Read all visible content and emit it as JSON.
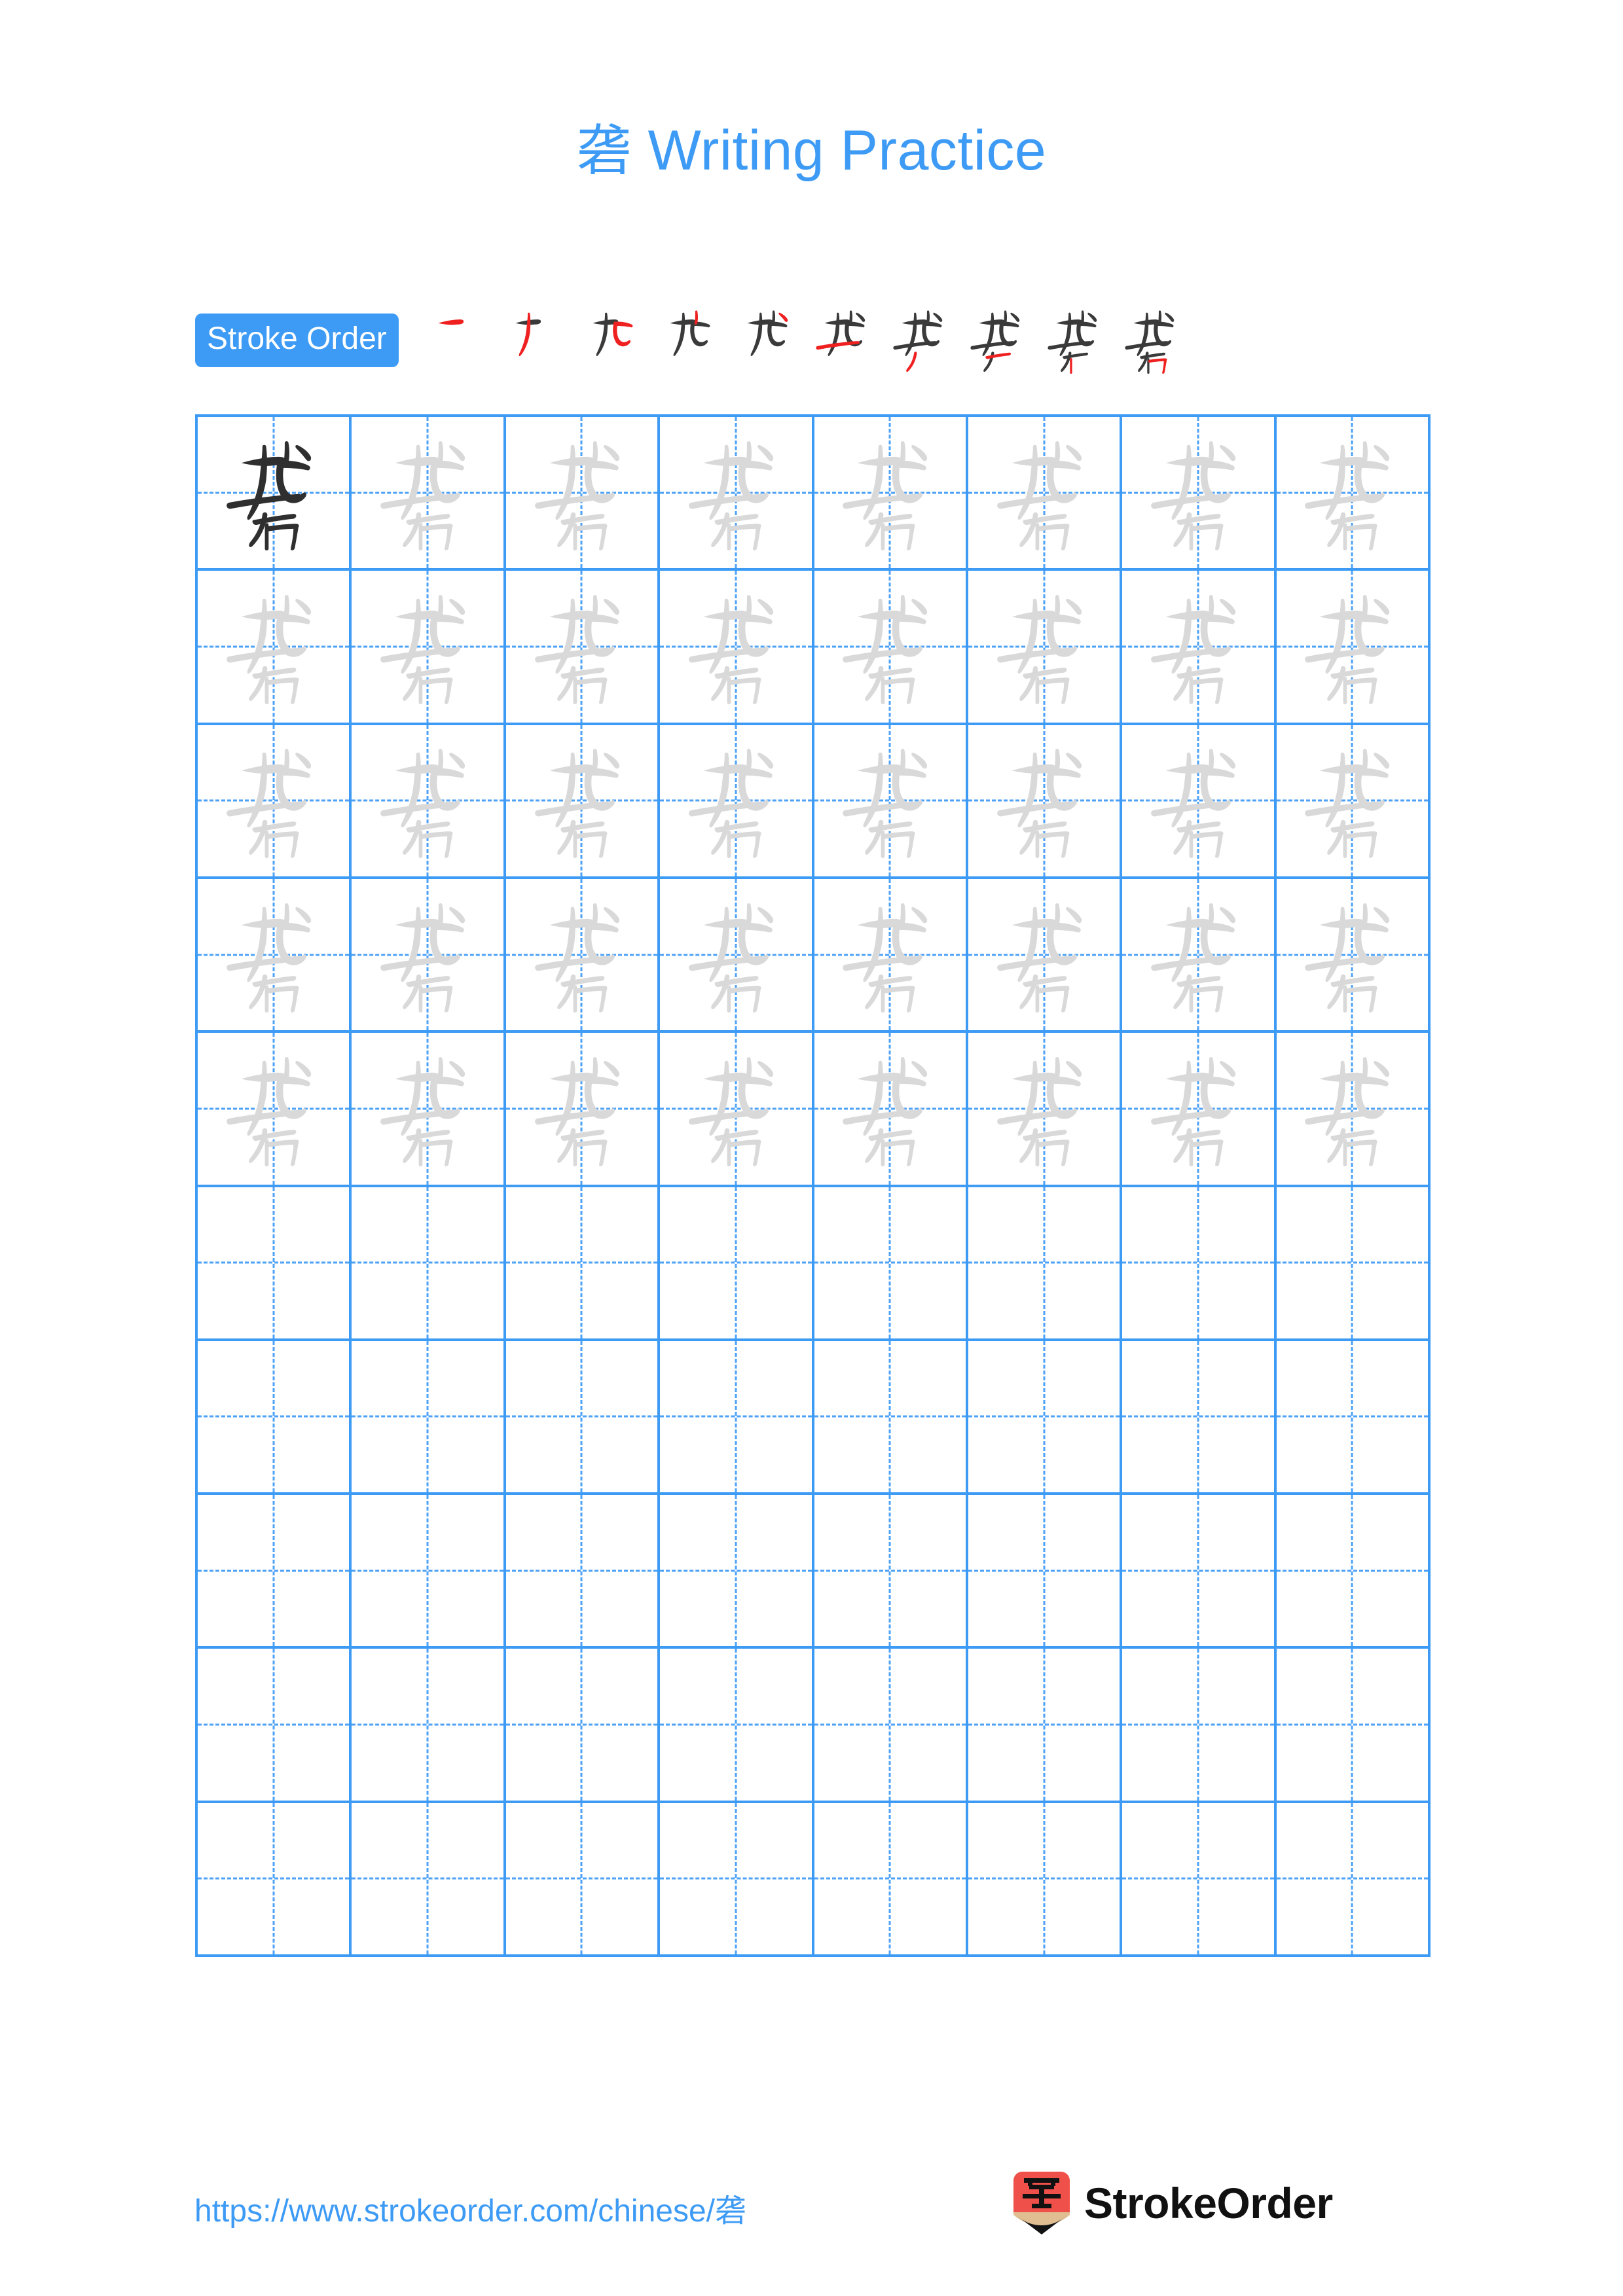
{
  "character": "砻",
  "colors": {
    "accent_blue": "#3d9bf5",
    "grid_line": "#3d9bf5",
    "guide_dash": "#4da2f7",
    "model_char": "#2f2f2f",
    "trace_char": "#d9d9d9",
    "stroke_existing": "#3a3a3a",
    "stroke_new": "#ef2020",
    "logo_red": "#f0504a",
    "logo_wood": "#e0be92",
    "page_background": "#ffffff"
  },
  "header": {
    "title_char": "砻",
    "title_text": " Writing Practice"
  },
  "stroke_order": {
    "badge_label": "Stroke Order",
    "total_strokes": 10,
    "steps": [
      {
        "index": 1,
        "name": "heng",
        "description": "横"
      },
      {
        "index": 2,
        "name": "pie",
        "description": "撇"
      },
      {
        "index": 3,
        "name": "heng-zhe-wan-gou",
        "description": "横折弯钩"
      },
      {
        "index": 4,
        "name": "pie-2",
        "description": "撇"
      },
      {
        "index": 5,
        "name": "dian",
        "description": "点"
      },
      {
        "index": 6,
        "name": "heng-2",
        "description": "横"
      },
      {
        "index": 7,
        "name": "pie-3",
        "description": "撇"
      },
      {
        "index": 8,
        "name": "heng-3",
        "description": "横"
      },
      {
        "index": 9,
        "name": "shu",
        "description": "竖"
      },
      {
        "index": 10,
        "name": "heng-zhe",
        "description": "横折"
      }
    ]
  },
  "grid": {
    "rows": 10,
    "columns": 8,
    "filled_rows": 5,
    "empty_rows": 5,
    "model_cell": {
      "row": 1,
      "column": 1
    }
  },
  "footer": {
    "url": "https://www.strokeorder.com/chinese/砻",
    "brand_name": "StrokeOrder",
    "logo_char": "字"
  }
}
